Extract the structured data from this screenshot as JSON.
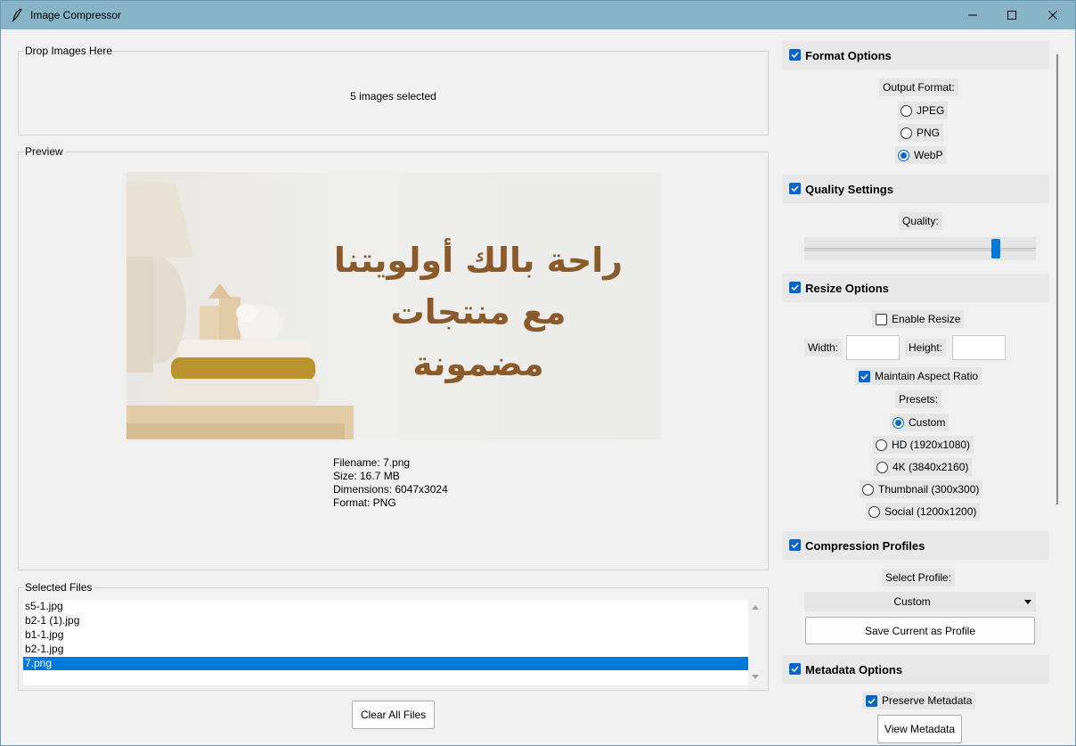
{
  "window": {
    "title": "Image Compressor"
  },
  "drop": {
    "label": "Drop Images Here",
    "status": "5 images selected"
  },
  "preview": {
    "label": "Preview",
    "image_text_line1": "راحة بالك أولويتنا",
    "image_text_line2": "مع منتجات مضمونة",
    "filename": "Filename: 7.png",
    "size": "Size: 16.7 MB",
    "dimensions": "Dimensions: 6047x3024",
    "format": "Format: PNG"
  },
  "files": {
    "label": "Selected Files",
    "items": [
      "s5-1.jpg",
      "b2-1 (1).jpg",
      "b1-1.jpg",
      "b2-1.jpg",
      "7.png"
    ],
    "selected_index": 4,
    "clear_label": "Clear All Files"
  },
  "format_options": {
    "title": "Format Options",
    "checked": true,
    "output_label": "Output Format:",
    "options": [
      "JPEG",
      "PNG",
      "WebP"
    ],
    "selected": "WebP"
  },
  "quality_settings": {
    "title": "Quality Settings",
    "checked": true,
    "quality_label": "Quality:",
    "quality_fraction": 0.84
  },
  "resize_options": {
    "title": "Resize Options",
    "checked": true,
    "enable_label": "Enable Resize",
    "enable_checked": false,
    "width_label": "Width:",
    "height_label": "Height:",
    "width_value": "",
    "height_value": "",
    "aspect_label": "Maintain Aspect Ratio",
    "aspect_checked": true,
    "presets_label": "Presets:",
    "presets": [
      "Custom",
      "HD (1920x1080)",
      "4K (3840x2160)",
      "Thumbnail (300x300)",
      "Social (1200x1200)"
    ],
    "preset_selected": "Custom"
  },
  "compression_profiles": {
    "title": "Compression Profiles",
    "checked": true,
    "select_label": "Select Profile:",
    "profile_value": "Custom",
    "save_label": "Save Current as Profile"
  },
  "metadata_options": {
    "title": "Metadata Options",
    "checked": true,
    "preserve_label": "Preserve Metadata",
    "preserve_checked": true,
    "view_label": "View Metadata"
  },
  "colors": {
    "titlebar": "#86b3c6",
    "accent": "#0066cc",
    "selection": "#0078d7",
    "image_text": "#8b5a2b"
  }
}
